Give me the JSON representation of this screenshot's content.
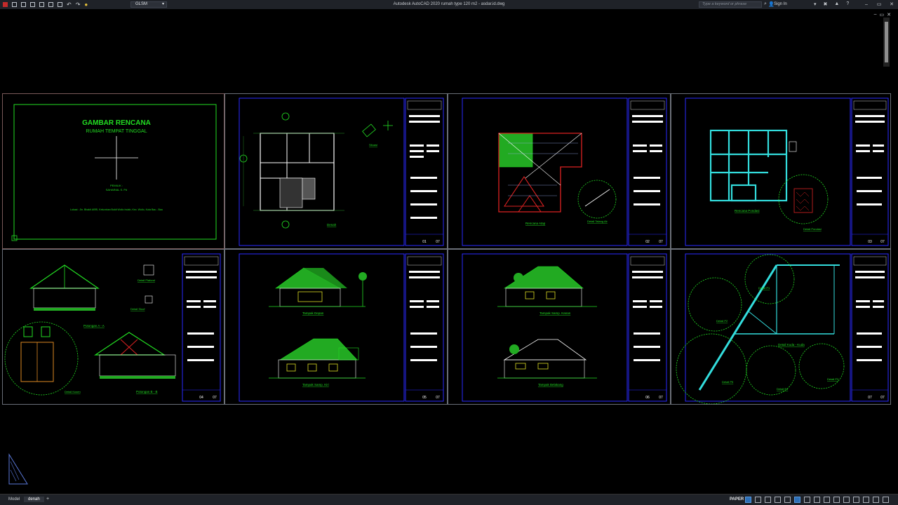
{
  "titlebar": {
    "workspace": "GLSM",
    "title": "Autodesk AutoCAD 2020    rumah type 120 m2 - asdar.id.dwg",
    "search_placeholder": "Type a keyword or phrase",
    "sign_in": "Sign In",
    "help": "?"
  },
  "cover": {
    "title": "GAMBAR RENCANA",
    "subtitle": "RUMAH TEMPAT TINGGAL",
    "owner_label": "PEMILIK :",
    "owner_name": "SAHARIAL S. Pd",
    "location": "Lokasi : Jln. Bhakti ABRI, Kelurahan Bukit Wolio Indah, Kec. Wolio, Kota Bau - Bau"
  },
  "sheets": [
    {
      "captions": [
        "Denah",
        "Situasi"
      ],
      "no": "01",
      "total": "07"
    },
    {
      "captions": [
        "Rencana Atap",
        "Detail Talang Air"
      ],
      "no": "02",
      "total": "07"
    },
    {
      "captions": [
        "Rencana Pondasi",
        "Detail Pondasi"
      ],
      "no": "03",
      "total": "07"
    },
    {
      "captions": [
        "Potongan A - A",
        "Detail Kusen",
        "Potongan B - B",
        "Detail Plafond",
        "Detail Sloof"
      ],
      "no": "04",
      "total": "07"
    },
    {
      "captions": [
        "Tampak Depan",
        "Tampak Samp. Kiri"
      ],
      "no": "05",
      "total": "07"
    },
    {
      "captions": [
        "Tampak Samp. Kanan",
        "Tampak Belakang"
      ],
      "no": "06",
      "total": "07"
    },
    {
      "captions": [
        "Detail P1",
        "Detail P2",
        "Detail Kuda - Kuda",
        "Detail P3",
        "Detail P4",
        "Detail P5"
      ],
      "no": "07",
      "total": "07"
    }
  ],
  "status": {
    "tabs": [
      "Model",
      "denah"
    ],
    "active_tab": "denah",
    "space": "PAPER"
  },
  "colors": {
    "background": "#000000",
    "titlebar": "#1f2228",
    "frame_blue": "#2a2aff",
    "cad_green": "#22dd22",
    "cad_cyan": "#33dddd"
  }
}
